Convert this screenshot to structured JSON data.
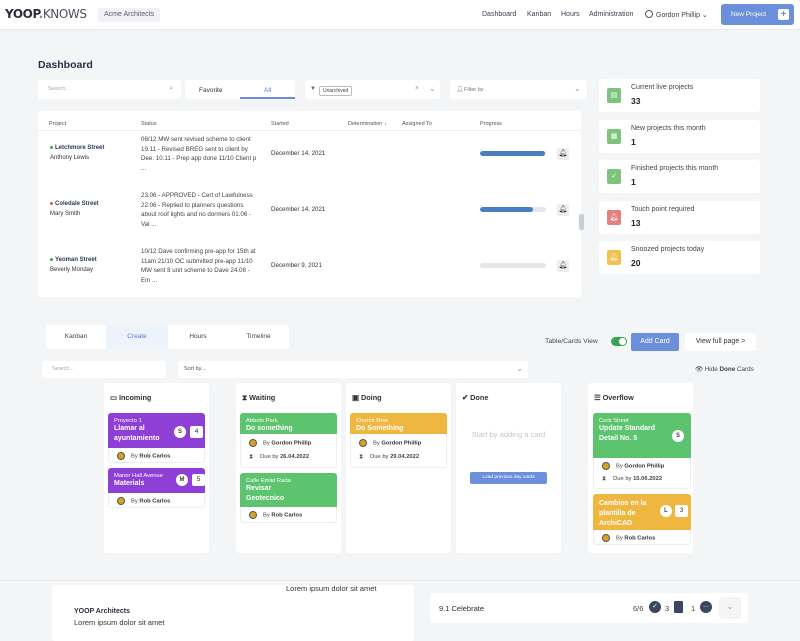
{
  "app": {
    "logo_main": "YOOP",
    "logo_sep": ".",
    "logo_sub": "KNOWS",
    "workspace": "Acme Architects"
  },
  "nav": {
    "links": [
      "Dashboard",
      "Kanban",
      "Hours",
      "Administration"
    ],
    "user": "Gordon Phillip",
    "new_project": "New Project",
    "new_project_icon": "+"
  },
  "dashboard": {
    "title": "Dashboard",
    "search_placeholder": "Search...",
    "tabs": [
      "Favorite",
      "All"
    ],
    "active_tab": "All",
    "tag": "Unarchived",
    "filter_placeholder": "Filter by",
    "columns": [
      "Project",
      "Status",
      "Started",
      "Determination",
      "Assigned To",
      "Progress"
    ],
    "rows": [
      {
        "name": "Letchmore Street",
        "person": "Anthony Lewis",
        "dot_color": "#3aa356",
        "status": "08/12 MW sent revised scheme to client 19.11 - Revised BREG sent to client by Dee. 10.11 - Prep app done 11/10 Client p ...",
        "started": "December 14, 2021",
        "progress": 0.98
      },
      {
        "name": "Coledale Street",
        "person": "Mary Smith",
        "dot_color": "#d9534f",
        "status": "23.06 - APPROVED - Cert of Lawfulness 22.06 - Replied to planners questions about roof lights and no dormers 01.06 - Val ...",
        "started": "December 14, 2021",
        "progress": 0.8
      },
      {
        "name": "Yeoman Street",
        "person": "Beverly Monday",
        "dot_color": "#3aa356",
        "status": "10/12 Dave confirming pre-app for 15th at 11am 21/10 OC submitted pre-app 11/10 MW sent 8 unit scheme to Dave 24.08 - Em ...",
        "started": "December 9, 2021",
        "progress": 0.0
      }
    ]
  },
  "stats": [
    {
      "label": "Current live projects",
      "value": "33",
      "color": "#7cc47c",
      "icon": "file-icon"
    },
    {
      "label": "New projects this month",
      "value": "1",
      "color": "#7cc47c",
      "icon": "calendar-plus-icon"
    },
    {
      "label": "Finished projects this month",
      "value": "1",
      "color": "#7cc47c",
      "icon": "calendar-check-icon"
    },
    {
      "label": "Touch point required",
      "value": "13",
      "color": "#e58080",
      "icon": "bell-icon"
    },
    {
      "label": "Snoozed projects today",
      "value": "20",
      "color": "#f2c14e",
      "icon": "bell-icon"
    }
  ],
  "kanban": {
    "tabs": [
      "Kanban",
      "Create",
      "Hours",
      "Timeline"
    ],
    "active_tab": "Create",
    "table_cards_label": "Table/Cards View",
    "add_card": "Add Card",
    "view_full": "View full page >",
    "search_placeholder": "Search...",
    "sort_placeholder": "Sort by...",
    "hide_label": "Hide",
    "hide_strong": "Done",
    "hide_suffix": "Cards",
    "by_prefix": "By",
    "due_prefix": "Due by",
    "columns": {
      "incoming": {
        "title": "Incoming",
        "cards": [
          {
            "pre": "Proyecto 1",
            "title": "Llamar al ayuntamiento",
            "badge": "S",
            "count": "4",
            "by": "Rob Carlos",
            "color": "#8e3fd6"
          },
          {
            "pre": "Manor Hall Avenue",
            "title": "Materials",
            "badge": "M",
            "count": "5",
            "by": "Rob Carlos",
            "color": "#8e3fd6"
          }
        ]
      },
      "waiting": {
        "title": "Waiting",
        "cards": [
          {
            "pre": "Abbots Park",
            "title": "Do something",
            "by": "Gordon Phillip",
            "due": "26.04.2022",
            "color": "#5cc46e"
          },
          {
            "pre": "Calle Emiid Rada",
            "title": "Revisar Geotecnico",
            "by": "Rob Carlos",
            "color": "#5cc46e"
          }
        ]
      },
      "doing": {
        "title": "Doing",
        "cards": [
          {
            "pre": "Church Row",
            "title": "Do Something",
            "by": "Gordon Phillip",
            "due": "29.04.2022",
            "color": "#f0b740"
          }
        ]
      },
      "done": {
        "title": "Done",
        "empty": "Start by adding a card",
        "load_button": "Load previous day cards"
      },
      "overflow": {
        "title": "Overflow",
        "cards": [
          {
            "pre": "Corb Street",
            "title": "Update Standard Detail No. 5",
            "badge": "S",
            "by": "Gordon Phillip",
            "due": "15.06.2022",
            "color": "#5cc46e"
          },
          {
            "title": "Cambios en la plantilla de ArchiCAD",
            "badge": "L",
            "count": "3",
            "by": "Rob Carlos",
            "color": "#f0b740"
          }
        ]
      }
    }
  },
  "footer": {
    "lorem_top": "Lorem ipsum dolor sit amet",
    "company": "YOOP Architects",
    "company_text": "Lorem ipsum dolor sit amet",
    "celebrate": "9.1 Celebrate",
    "fraction": "6/6",
    "files": "3",
    "comments": "1"
  }
}
